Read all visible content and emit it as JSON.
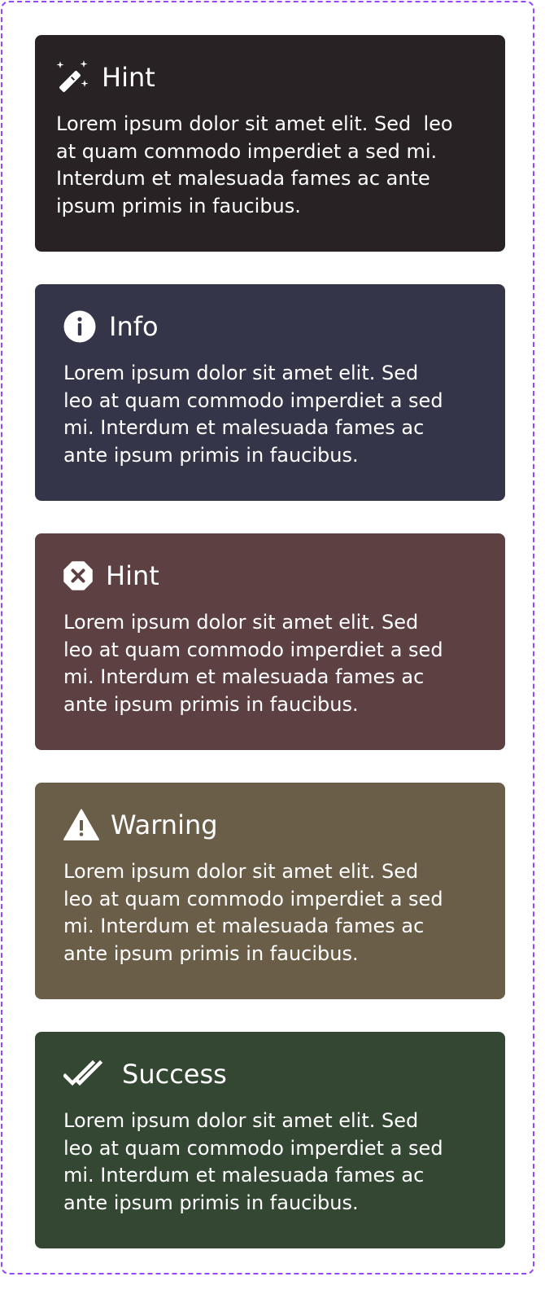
{
  "callouts": [
    {
      "title": "Hint",
      "icon": "magic-wand-icon",
      "background": "#282224",
      "body": [
        "Lorem ipsum dolor sit amet elit. Sed  leo",
        "at quam commodo imperdiet a sed mi.",
        "Interdum et malesuada fames ac ante",
        "ipsum primis in faucibus."
      ]
    },
    {
      "title": "Info",
      "icon": "info-circle-icon",
      "background": "#343548",
      "body": [
        "Lorem ipsum dolor sit amet elit. Sed",
        "leo at quam commodo imperdiet a sed",
        "mi. Interdum et malesuada fames ac",
        "ante ipsum primis in faucibus."
      ]
    },
    {
      "title": "Hint",
      "icon": "error-octagon-icon",
      "background": "#5d4042",
      "body": [
        "Lorem ipsum dolor sit amet elit. Sed",
        "leo at quam commodo imperdiet a sed",
        "mi. Interdum et malesuada fames ac",
        "ante ipsum primis in faucibus."
      ]
    },
    {
      "title": "Warning",
      "icon": "warning-triangle-icon",
      "background": "#6b5e48",
      "body": [
        "Lorem ipsum dolor sit amet elit. Sed",
        "leo at quam commodo imperdiet a sed",
        "mi. Interdum et malesuada fames ac",
        "ante ipsum primis in faucibus."
      ]
    },
    {
      "title": "Success",
      "icon": "double-check-icon",
      "background": "#344733",
      "body": [
        "Lorem ipsum dolor sit amet elit. Sed",
        "leo at quam commodo imperdiet a sed",
        "mi. Interdum et malesuada fames ac",
        "ante ipsum primis in faucibus."
      ]
    }
  ],
  "frame_border_color": "#9747ff"
}
